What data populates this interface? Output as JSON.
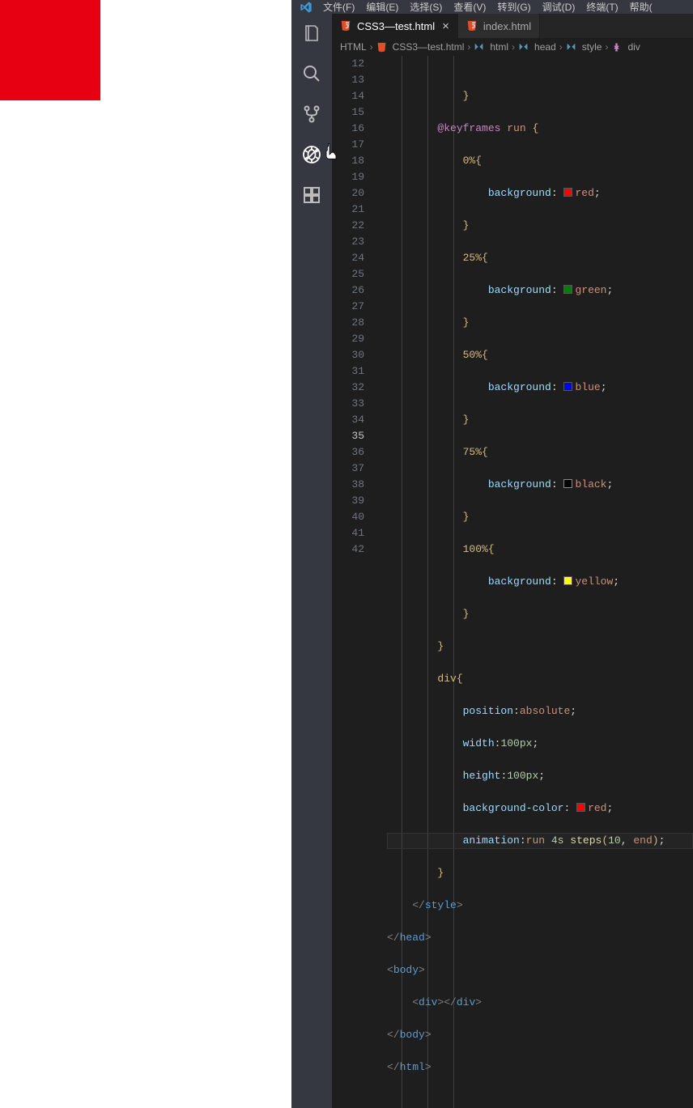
{
  "menu": {
    "items": [
      "文件(F)",
      "编辑(E)",
      "选择(S)",
      "查看(V)",
      "转到(G)",
      "调试(D)",
      "终端(T)",
      "帮助("
    ]
  },
  "tabs": [
    {
      "name": "CSS3—test.html",
      "active": true,
      "closeable": true
    },
    {
      "name": "index.html",
      "active": false,
      "closeable": false
    }
  ],
  "breadcrumb": {
    "folder": "HTML",
    "file": "CSS3—test.html",
    "path": [
      "html",
      "head",
      "style",
      "div"
    ]
  },
  "line_numbers": [
    12,
    13,
    14,
    15,
    16,
    17,
    18,
    19,
    20,
    21,
    22,
    23,
    24,
    25,
    26,
    27,
    28,
    29,
    30,
    31,
    32,
    33,
    34,
    35,
    36,
    37,
    38,
    39,
    40,
    41,
    42
  ],
  "current_line": 35,
  "code": {
    "l12": "}",
    "l13a": "@keyframes",
    "l13b": "run",
    "l13c": "{",
    "l14a": "0%",
    "l14b": "{",
    "l15a": "background",
    "l15b": "red",
    "l16": "}",
    "l17a": "25%",
    "l17b": "{",
    "l18a": "background",
    "l18b": "green",
    "l19": "}",
    "l20a": "50%",
    "l20b": "{",
    "l21a": "background",
    "l21b": "blue",
    "l22": "}",
    "l23a": "75%",
    "l23b": "{",
    "l24a": "background",
    "l24b": "black",
    "l25": "}",
    "l26a": "100%",
    "l26b": "{",
    "l27a": "background",
    "l27b": "yellow",
    "l28": "}",
    "l29": "}",
    "l30a": "div",
    "l30b": "{",
    "l31a": "position",
    "l31b": "absolute",
    "l32a": "width",
    "l32b": "100px",
    "l33a": "height",
    "l33b": "100px",
    "l34a": "background-color",
    "l34b": "red",
    "l35a": "animation",
    "l35b": "run",
    "l35c": "4s",
    "l35d": "steps",
    "l35e": "10",
    "l35f": "end",
    "l36": "}",
    "l37a": "</",
    "l37b": "style",
    "l37c": ">",
    "l38a": "</",
    "l38b": "head",
    "l38c": ">",
    "l39a": "<",
    "l39b": "body",
    "l39c": ">",
    "l40a": "<",
    "l40b": "div",
    "l40c": "></",
    "l40d": "div",
    "l40e": ">",
    "l41a": "</",
    "l41b": "body",
    "l41c": ">",
    "l42a": "</",
    "l42b": "html",
    "l42c": ">"
  }
}
